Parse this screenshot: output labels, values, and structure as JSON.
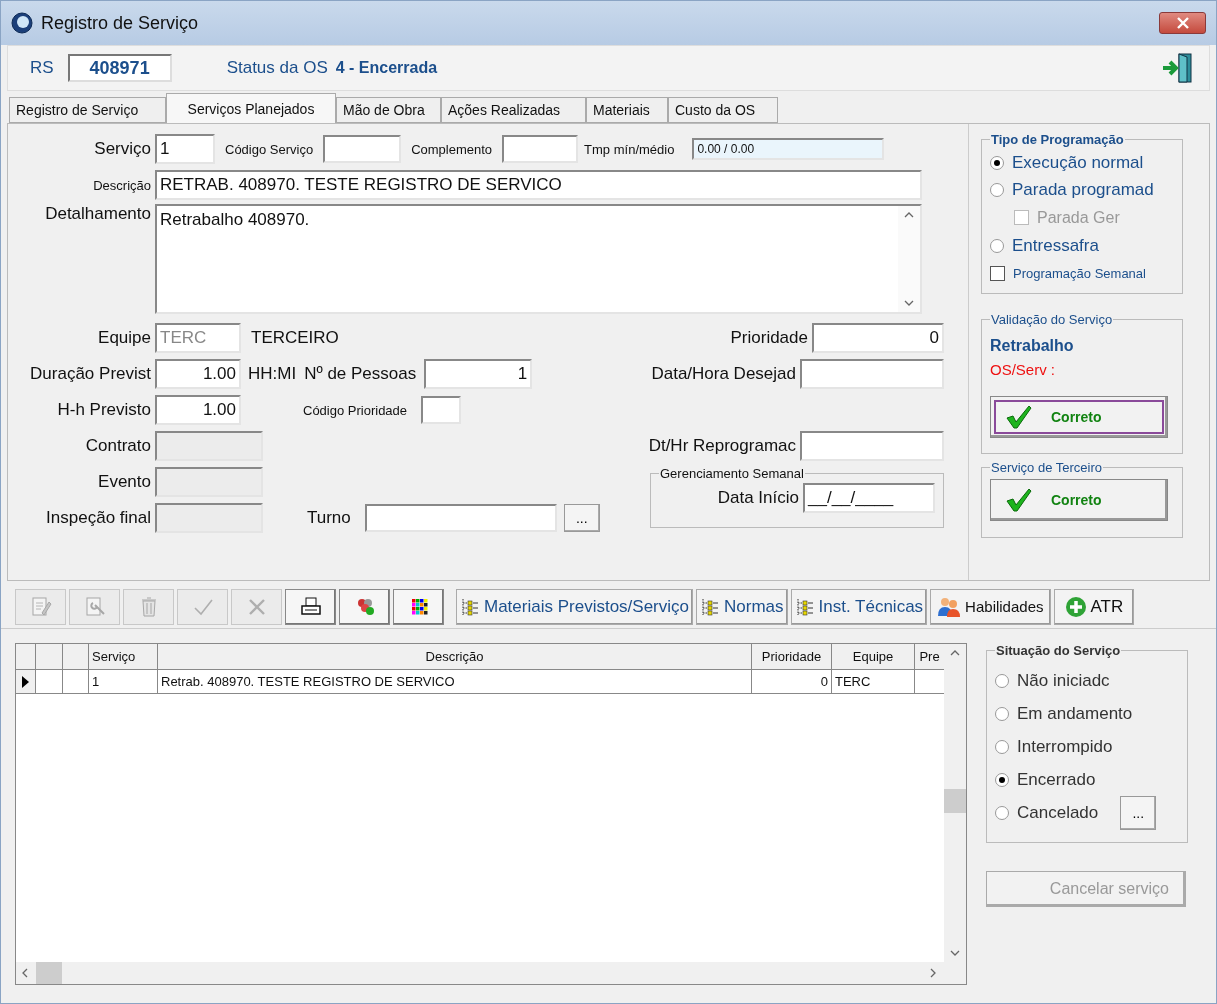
{
  "window": {
    "title": "Registro de Serviço"
  },
  "header": {
    "rs_label": "RS",
    "rs_value": "408971",
    "status_label": "Status da OS",
    "status_value": "4 - Encerrada"
  },
  "tabs": [
    {
      "label": "Registro de Serviço",
      "selected": false
    },
    {
      "label": "Serviços Planejados",
      "selected": true
    },
    {
      "label": "Mão de Obra",
      "selected": false
    },
    {
      "label": "Ações Realizadas",
      "selected": false
    },
    {
      "label": "Materiais",
      "selected": false
    },
    {
      "label": "Custo da OS",
      "selected": false
    }
  ],
  "form": {
    "servico": {
      "label": "Serviço",
      "value": "1"
    },
    "codigo_servico": {
      "label": "Código Serviço"
    },
    "complemento": {
      "label": "Complemento"
    },
    "tmp": {
      "label": "Tmp mín/médio",
      "value": "0.00 / 0.00"
    },
    "descricao": {
      "label": "Descrição",
      "value": "RETRAB. 408970. TESTE REGISTRO DE SERVICO"
    },
    "detalhamento": {
      "label": "Detalhamento",
      "value": "Retrabalho 408970."
    },
    "equipe": {
      "label": "Equipe",
      "value": "TERC",
      "disabled": true,
      "name": "TERCEIRO"
    },
    "duracao": {
      "label": "Duração Previst",
      "value": "1.00",
      "unit": "HH:MI"
    },
    "pessoas": {
      "label": "Nº de Pessoas",
      "value": "1"
    },
    "hh": {
      "label": "H-h Previsto",
      "value": "1.00"
    },
    "codigo_prioridade": {
      "label": "Código Prioridade"
    },
    "contrato": {
      "label": "Contrato",
      "disabled": true
    },
    "evento": {
      "label": "Evento",
      "disabled": true
    },
    "inspecao": {
      "label": "Inspeção final",
      "disabled": true
    },
    "turno": {
      "label": "Turno",
      "button": "..."
    },
    "prioridade": {
      "label": "Prioridade",
      "value": "0"
    },
    "data_desejada": {
      "label": "Data/Hora Desejad"
    },
    "reprogramada": {
      "label": "Dt/Hr Reprogramac"
    },
    "gerenciamento": {
      "title": "Gerenciamento Semanal",
      "label": "Data Início",
      "value": "__/__/____"
    }
  },
  "tipo_programacao": {
    "title": "Tipo de Programação",
    "items": [
      {
        "kind": "radio",
        "label": "Execução normal",
        "selected": true,
        "disabled": false
      },
      {
        "kind": "radio",
        "label": "Parada programad",
        "selected": false,
        "disabled": false,
        "children": [
          {
            "kind": "checkbox",
            "label": "Parada Ger",
            "checked": false,
            "disabled": true
          }
        ]
      },
      {
        "kind": "radio",
        "label": "Entressafra",
        "selected": false,
        "disabled": false
      },
      {
        "kind": "checkbox",
        "label": "Programação Semanal",
        "checked": false,
        "disabled": false
      }
    ]
  },
  "validacao": {
    "title": "Validação do Serviço",
    "status": "Retrabalho",
    "note": "OS/Serv :",
    "button": {
      "label": "Correto",
      "focused": true
    }
  },
  "terceiro": {
    "title": "Serviço de Terceiro",
    "button": {
      "label": "Correto",
      "focused": false
    }
  },
  "toolbar": {
    "icon_buttons": [
      {
        "disabled": true
      },
      {
        "disabled": true
      },
      {
        "disabled": true
      },
      {
        "disabled": true
      },
      {
        "disabled": true
      },
      {
        "disabled": false
      },
      {
        "disabled": false
      },
      {
        "disabled": false
      }
    ],
    "text_buttons": [
      {
        "kind": "tree",
        "label": "Materiais Previstos/Serviço"
      },
      {
        "kind": "tree",
        "label": "Normas"
      },
      {
        "kind": "tree",
        "label": "Inst. Técnicas"
      },
      {
        "kind": "people",
        "label": "Habilidades"
      },
      {
        "kind": "add",
        "label": "ATR"
      }
    ]
  },
  "table": {
    "columns": [
      "Serviço",
      "Descrição",
      "Prioridade",
      "Equipe",
      "Pre"
    ],
    "rows": [
      {
        "selected": true,
        "cells": [
          "1",
          "Retrab. 408970. TESTE REGISTRO DE SERVICO",
          "0",
          "TERC"
        ]
      }
    ]
  },
  "situacao": {
    "title": "Situação do Serviço",
    "options": [
      {
        "label": "Não iniciadc",
        "selected": false
      },
      {
        "label": "Em andamento",
        "selected": false
      },
      {
        "label": "Interrompido",
        "selected": false
      },
      {
        "label": "Encerrado",
        "selected": true
      },
      {
        "label": "Cancelado",
        "selected": false
      }
    ],
    "more_button": "..."
  },
  "cancel_button": {
    "label": "Cancelar serviço",
    "disabled": true
  }
}
